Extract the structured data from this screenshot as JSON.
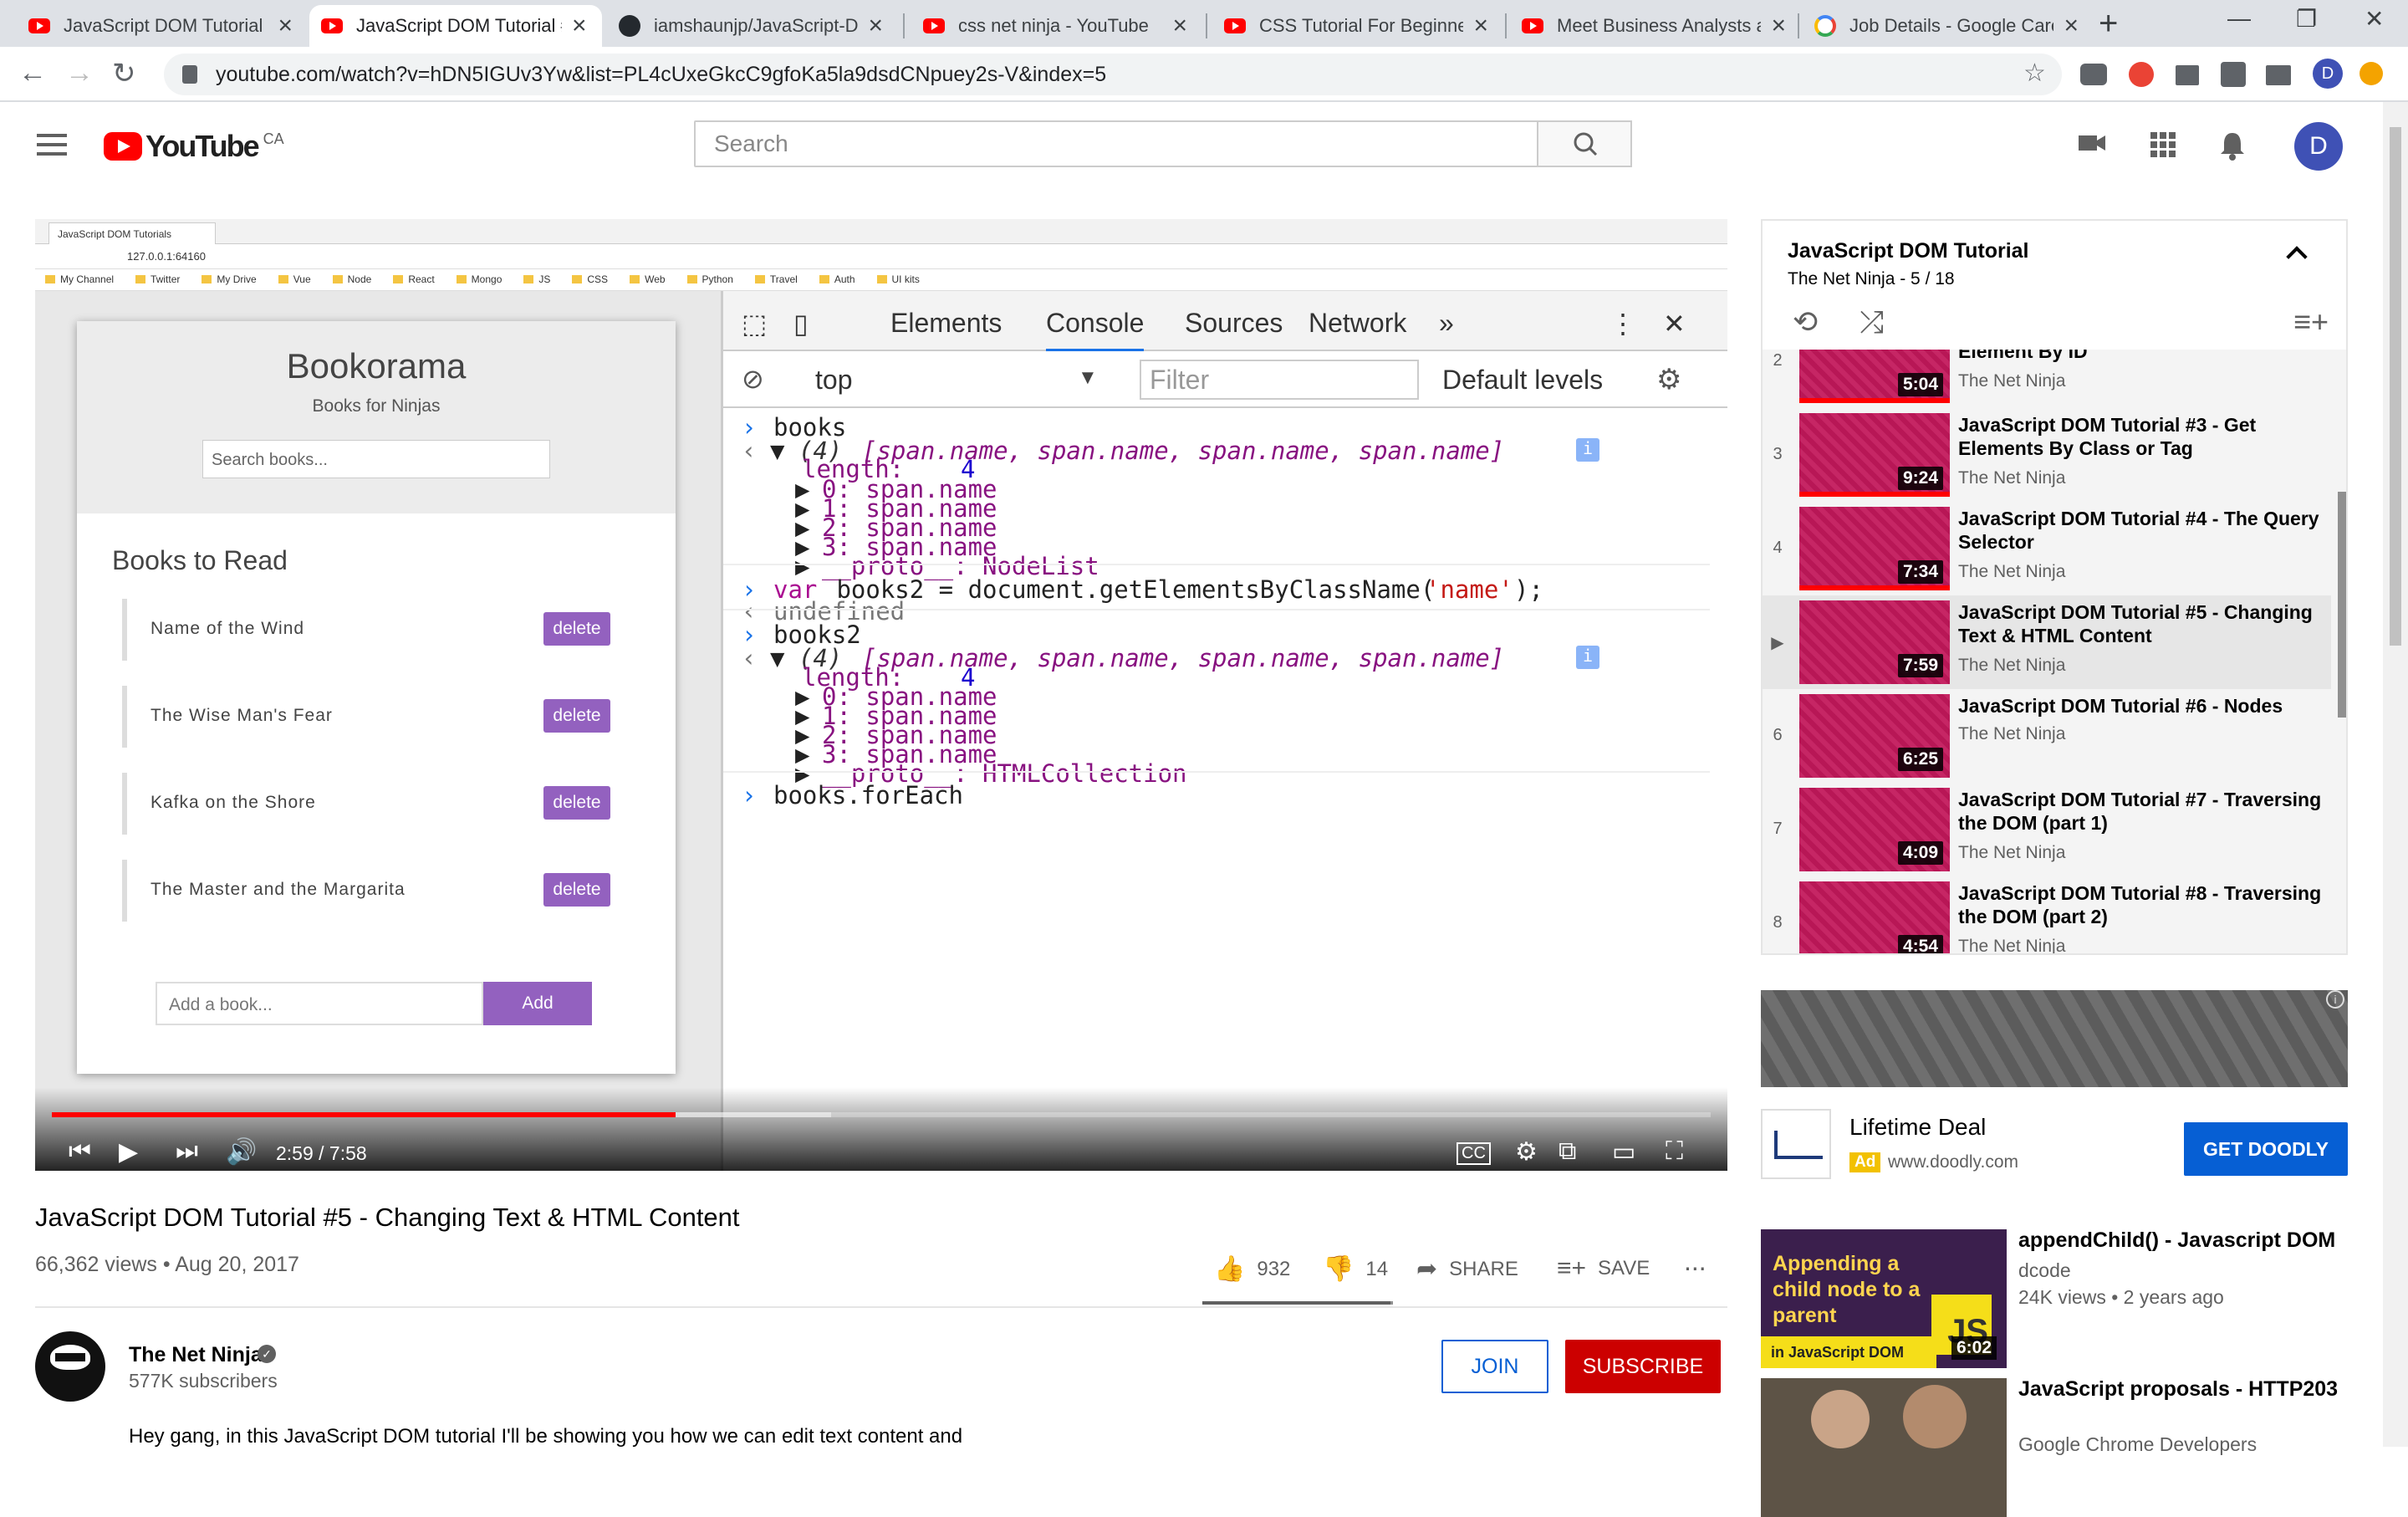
{
  "browser": {
    "tabs": [
      {
        "label": "JavaScript DOM Tutorial #",
        "icon": "youtube-icon"
      },
      {
        "label": "JavaScript DOM Tutorial #",
        "icon": "youtube-icon",
        "active": true
      },
      {
        "label": "iamshaunjp/JavaScript-DO",
        "icon": "github-icon"
      },
      {
        "label": "css net ninja - YouTube",
        "icon": "youtube-icon"
      },
      {
        "label": "CSS Tutorial For Beginner",
        "icon": "youtube-icon"
      },
      {
        "label": "Meet Business Analysts at",
        "icon": "youtube-icon"
      },
      {
        "label": "Job Details - Google Caree",
        "icon": "google-icon"
      }
    ],
    "new_tab": "+",
    "url": "youtube.com/watch?v=hDN5IGUv3Yw&list=PL4cUxeGkcC9gfoKa5la9dsdCNpuey2s-V&index=5",
    "profile_initial": "D"
  },
  "youtube": {
    "logo_text": "YouTube",
    "country": "CA",
    "search_placeholder": "Search",
    "avatar_initial": "D"
  },
  "video": {
    "recorded_browser": {
      "tab_label": "JavaScript DOM Tutorials",
      "url": "127.0.0.1:64160",
      "bookmarks": [
        "My Channel",
        "Twitter",
        "My Drive",
        "Vue",
        "Node",
        "React",
        "Mongo",
        "JS",
        "CSS",
        "Web",
        "Python",
        "Travel",
        "Auth",
        "UI kits"
      ]
    },
    "bookorama": {
      "title": "Bookorama",
      "subtitle": "Books for Ninjas",
      "search_placeholder": "Search books...",
      "list_title": "Books to Read",
      "books": [
        "Name of the Wind",
        "The Wise Man's Fear",
        "Kafka on the Shore",
        "The Master and the Margarita"
      ],
      "delete_label": "delete",
      "add_placeholder": "Add a book...",
      "add_label": "Add"
    },
    "devtools": {
      "tabs": [
        "Elements",
        "Console",
        "Sources",
        "Network",
        "»"
      ],
      "active_tab": "Console",
      "context": "top",
      "filter_placeholder": "Filter",
      "levels": "Default levels",
      "console": {
        "l1_input": "books",
        "l2_result_count": "(4)",
        "l2_items": "[span.name, span.name, span.name, span.name]",
        "length_key": "length:",
        "length_val": "4",
        "nodes": [
          "0: span.name",
          "1: span.name",
          "2: span.name",
          "3: span.name"
        ],
        "proto1": "__proto__: NodeList",
        "l3_kw": "var",
        "l3_code": " books2 = document.getElementsByClassName(",
        "l3_str": "'name'",
        "l3_end": ");",
        "l3_result": "undefined",
        "l4_input": "books2",
        "l5_result_count": "(4)",
        "l5_items": "[span.name, span.name, span.name, span.name]",
        "length2_val": "4",
        "nodes2": [
          "0: span.name",
          "1: span.name",
          "2: span.name",
          "3: span.name"
        ],
        "proto2": "__proto__: HTMLCollection",
        "l6_input": "books.forEach"
      }
    },
    "player": {
      "time": "2:59 / 7:58",
      "progress": 0.376,
      "buffered": 0.47
    },
    "title": "JavaScript DOM Tutorial #5 - Changing Text & HTML Content",
    "views": "66,362 views",
    "date": "Aug 20, 2017",
    "likes": "932",
    "dislikes": "14",
    "like_ratio": 0.985,
    "share": "SHARE",
    "save": "SAVE",
    "more": "..."
  },
  "channel": {
    "name": "The Net Ninja",
    "subscribers": "577K subscribers",
    "join": "JOIN",
    "subscribe": "SUBSCRIBE",
    "description": "Hey gang, in this JavaScript DOM tutorial I'll be showing you how we can edit text content and"
  },
  "playlist": {
    "title": "JavaScript DOM Tutorial",
    "owner_position": "The Net Ninja - 5 / 18",
    "items": [
      {
        "index": "2",
        "title": "Element By ID",
        "channel": "The Net Ninja",
        "duration": "5:04"
      },
      {
        "index": "3",
        "title": "JavaScript DOM Tutorial #3 - Get Elements By Class or Tag",
        "channel": "The Net Ninja",
        "duration": "9:24"
      },
      {
        "index": "4",
        "title": "JavaScript DOM Tutorial #4 - The Query Selector",
        "channel": "The Net Ninja",
        "duration": "7:34"
      },
      {
        "index": "▶",
        "title": "JavaScript DOM Tutorial #5 - Changing Text & HTML Content",
        "channel": "The Net Ninja",
        "duration": "7:59"
      },
      {
        "index": "6",
        "title": "JavaScript DOM Tutorial #6 - Nodes",
        "channel": "The Net Ninja",
        "duration": "6:25"
      },
      {
        "index": "7",
        "title": "JavaScript DOM Tutorial #7 - Traversing the DOM (part 1)",
        "channel": "The Net Ninja",
        "duration": "4:09"
      },
      {
        "index": "8",
        "title": "JavaScript DOM Tutorial #8 - Traversing the DOM (part 2)",
        "channel": "The Net Ninja",
        "duration": "4:54"
      }
    ]
  },
  "ad": {
    "title": "Lifetime Deal",
    "tag": "Ad",
    "url": "www.doodly.com",
    "button": "GET DOODLY"
  },
  "related": [
    {
      "title": "appendChild() - Javascript DOM",
      "channel": "dcode",
      "meta": "24K views • 2 years ago",
      "duration": "6:02",
      "thumb_text": "Appending a child node to a parent",
      "thumb_badge": "in JavaScript DOM",
      "thumb_js": "JS"
    },
    {
      "title": "JavaScript proposals - HTTP203",
      "channel": "Google Chrome Developers"
    }
  ],
  "colors": {
    "youtube_red": "#ff0000",
    "subscribe_red": "#cc0000",
    "link_blue": "#065fd4",
    "bookorama_purple": "#9361bf",
    "thumb_magenta": "#c2185b"
  }
}
